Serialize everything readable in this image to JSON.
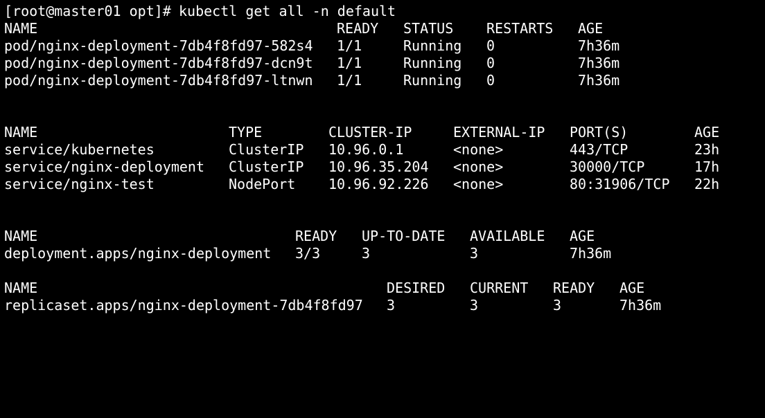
{
  "terminal": {
    "prompt": "[root@master01 opt]# ",
    "command": "kubectl get all -n default"
  },
  "pods": {
    "headers": [
      "NAME",
      "READY",
      "STATUS",
      "RESTARTS",
      "AGE"
    ],
    "rows": [
      [
        "pod/nginx-deployment-7db4f8fd97-582s4",
        "1/1",
        "Running",
        "0",
        "7h36m"
      ],
      [
        "pod/nginx-deployment-7db4f8fd97-dcn9t",
        "1/1",
        "Running",
        "0",
        "7h36m"
      ],
      [
        "pod/nginx-deployment-7db4f8fd97-ltnwn",
        "1/1",
        "Running",
        "0",
        "7h36m"
      ]
    ]
  },
  "services": {
    "headers": [
      "NAME",
      "TYPE",
      "CLUSTER-IP",
      "EXTERNAL-IP",
      "PORT(S)",
      "AGE"
    ],
    "rows": [
      [
        "service/kubernetes",
        "ClusterIP",
        "10.96.0.1",
        "<none>",
        "443/TCP",
        "23h"
      ],
      [
        "service/nginx-deployment",
        "ClusterIP",
        "10.96.35.204",
        "<none>",
        "30000/TCP",
        "17h"
      ],
      [
        "service/nginx-test",
        "NodePort",
        "10.96.92.226",
        "<none>",
        "80:31906/TCP",
        "22h"
      ]
    ]
  },
  "deployments": {
    "headers": [
      "NAME",
      "READY",
      "UP-TO-DATE",
      "AVAILABLE",
      "AGE"
    ],
    "rows": [
      [
        "deployment.apps/nginx-deployment",
        "3/3",
        "3",
        "3",
        "7h36m"
      ]
    ]
  },
  "replicasets": {
    "headers": [
      "NAME",
      "DESIRED",
      "CURRENT",
      "READY",
      "AGE"
    ],
    "rows": [
      [
        "replicaset.apps/nginx-deployment-7db4f8fd97",
        "3",
        "3",
        "3",
        "7h36m"
      ]
    ]
  },
  "colors": {
    "background": "#000000",
    "foreground": "#ffffff"
  }
}
